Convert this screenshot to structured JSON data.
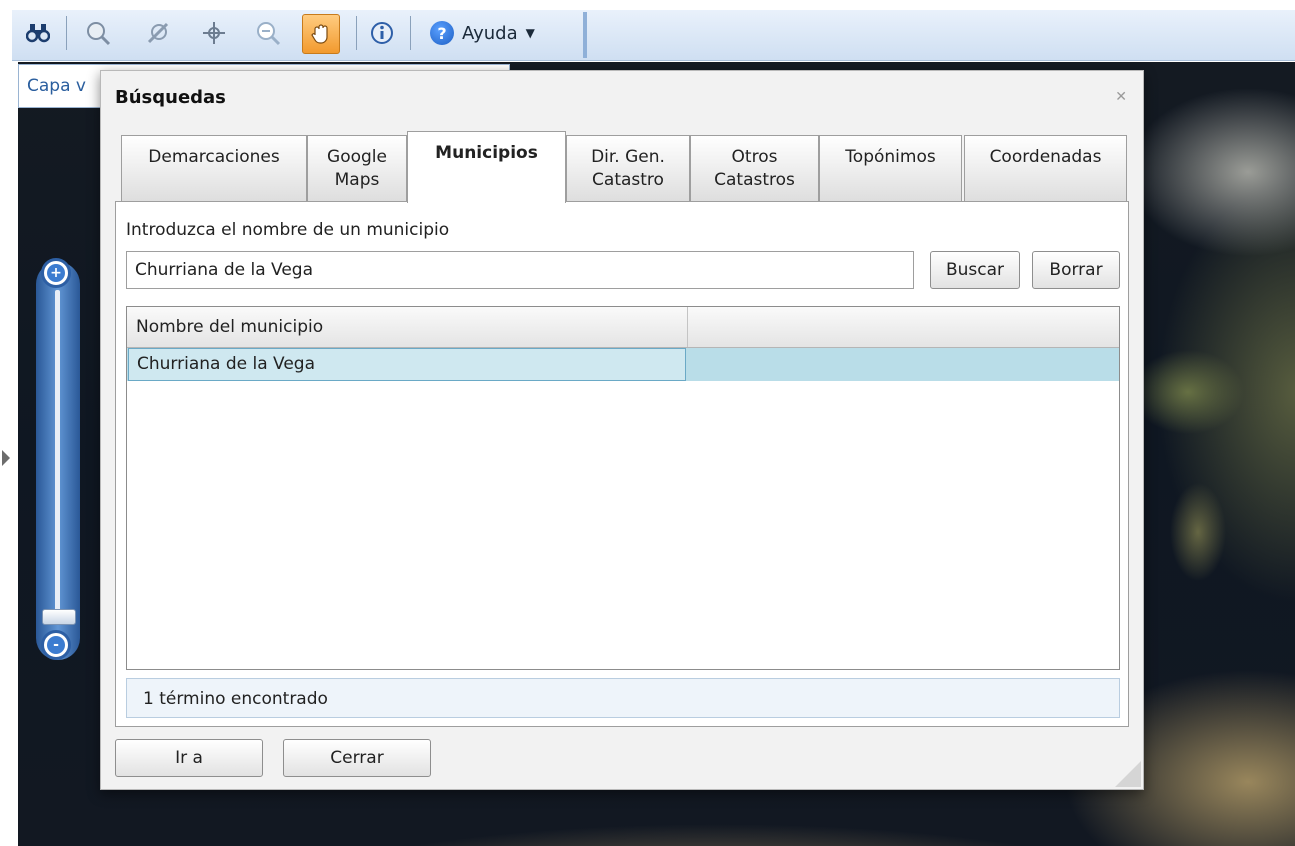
{
  "toolbar": {
    "tools": [
      {
        "icon": "binoculars-icon"
      },
      {
        "icon": "zoom-extent-icon"
      },
      {
        "icon": "measure-icon"
      },
      {
        "icon": "crosshair-icon"
      },
      {
        "icon": "zoom-out-icon"
      },
      {
        "icon": "pan-hand-icon",
        "active": true
      },
      {
        "icon": "info-icon"
      }
    ],
    "help_label": "Ayuda",
    "accent": "#f29a2e"
  },
  "layer_tab": {
    "label": "Capa v"
  },
  "dialog": {
    "title": "Búsquedas",
    "tabs": [
      {
        "line1": "Demarcaciones",
        "line2": ""
      },
      {
        "line1": "Google",
        "line2": "Maps"
      },
      {
        "line1": "Municipios",
        "line2": "",
        "active": true
      },
      {
        "line1": "Dir. Gen.",
        "line2": "Catastro"
      },
      {
        "line1": "Otros",
        "line2": "Catastros"
      },
      {
        "line1": "Topónimos",
        "line2": ""
      },
      {
        "line1": "Coordenadas",
        "line2": ""
      }
    ],
    "prompt": "Introduzca el nombre de un municipio",
    "search_value": "Churriana de la Vega",
    "search_button": "Buscar",
    "clear_button": "Borrar",
    "grid": {
      "headers": [
        "Nombre del municipio",
        ""
      ],
      "rows": [
        [
          "Churriana de la Vega",
          ""
        ]
      ]
    },
    "status": "1 término encontrado",
    "goto_button": "Ir a",
    "close_button": "Cerrar"
  }
}
